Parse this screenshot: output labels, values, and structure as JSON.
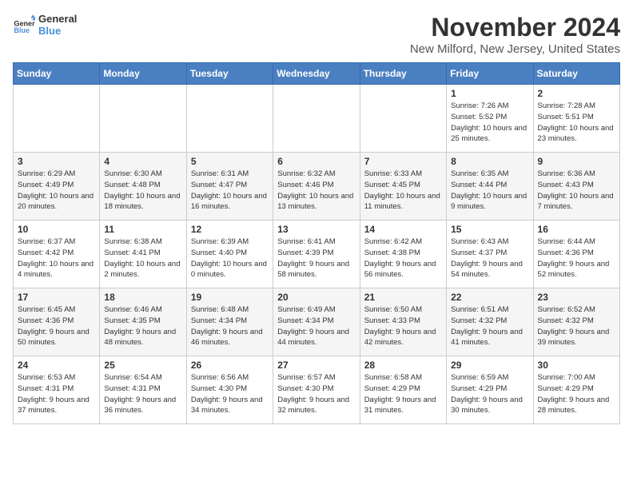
{
  "logo": {
    "line1": "General",
    "line2": "Blue"
  },
  "title": "November 2024",
  "subtitle": "New Milford, New Jersey, United States",
  "days_of_week": [
    "Sunday",
    "Monday",
    "Tuesday",
    "Wednesday",
    "Thursday",
    "Friday",
    "Saturday"
  ],
  "weeks": [
    [
      {
        "day": "",
        "info": ""
      },
      {
        "day": "",
        "info": ""
      },
      {
        "day": "",
        "info": ""
      },
      {
        "day": "",
        "info": ""
      },
      {
        "day": "",
        "info": ""
      },
      {
        "day": "1",
        "info": "Sunrise: 7:26 AM\nSunset: 5:52 PM\nDaylight: 10 hours and 25 minutes."
      },
      {
        "day": "2",
        "info": "Sunrise: 7:28 AM\nSunset: 5:51 PM\nDaylight: 10 hours and 23 minutes."
      }
    ],
    [
      {
        "day": "3",
        "info": "Sunrise: 6:29 AM\nSunset: 4:49 PM\nDaylight: 10 hours and 20 minutes."
      },
      {
        "day": "4",
        "info": "Sunrise: 6:30 AM\nSunset: 4:48 PM\nDaylight: 10 hours and 18 minutes."
      },
      {
        "day": "5",
        "info": "Sunrise: 6:31 AM\nSunset: 4:47 PM\nDaylight: 10 hours and 16 minutes."
      },
      {
        "day": "6",
        "info": "Sunrise: 6:32 AM\nSunset: 4:46 PM\nDaylight: 10 hours and 13 minutes."
      },
      {
        "day": "7",
        "info": "Sunrise: 6:33 AM\nSunset: 4:45 PM\nDaylight: 10 hours and 11 minutes."
      },
      {
        "day": "8",
        "info": "Sunrise: 6:35 AM\nSunset: 4:44 PM\nDaylight: 10 hours and 9 minutes."
      },
      {
        "day": "9",
        "info": "Sunrise: 6:36 AM\nSunset: 4:43 PM\nDaylight: 10 hours and 7 minutes."
      }
    ],
    [
      {
        "day": "10",
        "info": "Sunrise: 6:37 AM\nSunset: 4:42 PM\nDaylight: 10 hours and 4 minutes."
      },
      {
        "day": "11",
        "info": "Sunrise: 6:38 AM\nSunset: 4:41 PM\nDaylight: 10 hours and 2 minutes."
      },
      {
        "day": "12",
        "info": "Sunrise: 6:39 AM\nSunset: 4:40 PM\nDaylight: 10 hours and 0 minutes."
      },
      {
        "day": "13",
        "info": "Sunrise: 6:41 AM\nSunset: 4:39 PM\nDaylight: 9 hours and 58 minutes."
      },
      {
        "day": "14",
        "info": "Sunrise: 6:42 AM\nSunset: 4:38 PM\nDaylight: 9 hours and 56 minutes."
      },
      {
        "day": "15",
        "info": "Sunrise: 6:43 AM\nSunset: 4:37 PM\nDaylight: 9 hours and 54 minutes."
      },
      {
        "day": "16",
        "info": "Sunrise: 6:44 AM\nSunset: 4:36 PM\nDaylight: 9 hours and 52 minutes."
      }
    ],
    [
      {
        "day": "17",
        "info": "Sunrise: 6:45 AM\nSunset: 4:36 PM\nDaylight: 9 hours and 50 minutes."
      },
      {
        "day": "18",
        "info": "Sunrise: 6:46 AM\nSunset: 4:35 PM\nDaylight: 9 hours and 48 minutes."
      },
      {
        "day": "19",
        "info": "Sunrise: 6:48 AM\nSunset: 4:34 PM\nDaylight: 9 hours and 46 minutes."
      },
      {
        "day": "20",
        "info": "Sunrise: 6:49 AM\nSunset: 4:34 PM\nDaylight: 9 hours and 44 minutes."
      },
      {
        "day": "21",
        "info": "Sunrise: 6:50 AM\nSunset: 4:33 PM\nDaylight: 9 hours and 42 minutes."
      },
      {
        "day": "22",
        "info": "Sunrise: 6:51 AM\nSunset: 4:32 PM\nDaylight: 9 hours and 41 minutes."
      },
      {
        "day": "23",
        "info": "Sunrise: 6:52 AM\nSunset: 4:32 PM\nDaylight: 9 hours and 39 minutes."
      }
    ],
    [
      {
        "day": "24",
        "info": "Sunrise: 6:53 AM\nSunset: 4:31 PM\nDaylight: 9 hours and 37 minutes."
      },
      {
        "day": "25",
        "info": "Sunrise: 6:54 AM\nSunset: 4:31 PM\nDaylight: 9 hours and 36 minutes."
      },
      {
        "day": "26",
        "info": "Sunrise: 6:56 AM\nSunset: 4:30 PM\nDaylight: 9 hours and 34 minutes."
      },
      {
        "day": "27",
        "info": "Sunrise: 6:57 AM\nSunset: 4:30 PM\nDaylight: 9 hours and 32 minutes."
      },
      {
        "day": "28",
        "info": "Sunrise: 6:58 AM\nSunset: 4:29 PM\nDaylight: 9 hours and 31 minutes."
      },
      {
        "day": "29",
        "info": "Sunrise: 6:59 AM\nSunset: 4:29 PM\nDaylight: 9 hours and 30 minutes."
      },
      {
        "day": "30",
        "info": "Sunrise: 7:00 AM\nSunset: 4:29 PM\nDaylight: 9 hours and 28 minutes."
      }
    ]
  ]
}
